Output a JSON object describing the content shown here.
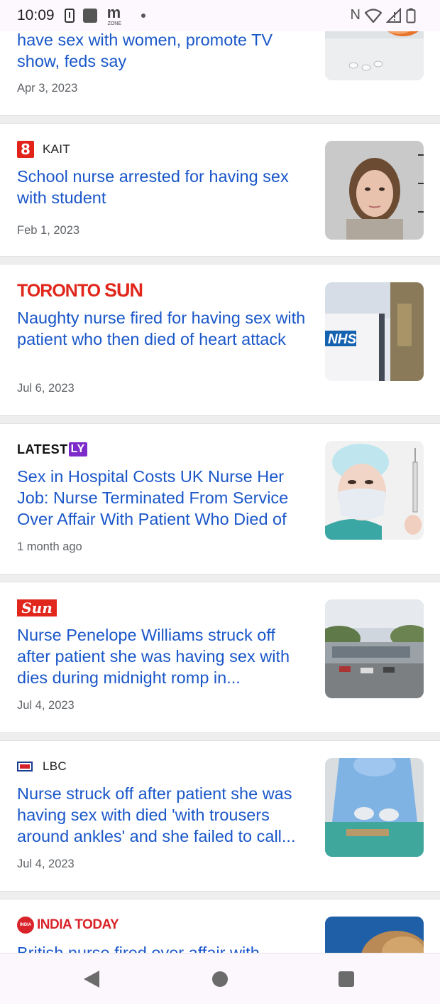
{
  "status_bar": {
    "time": "10:09",
    "mzone_letter": "m",
    "mzone_text": "ZONE",
    "nfc_letter": "N",
    "icons": [
      "alert-icon",
      "app-square-icon",
      "mzone-icon",
      "dot-icon",
      "nfc-icon",
      "wifi-icon",
      "signal-icon",
      "battery-icon"
    ]
  },
  "articles": [
    {
      "source": "",
      "headline": "have sex with women, promote TV show, feds say",
      "date": "Apr 3, 2023",
      "thumb": "pills-image"
    },
    {
      "source": "KAIT",
      "logo_glyph": "8",
      "headline": "School nurse arrested for having sex with student",
      "date": "Feb 1, 2023",
      "thumb": "mugshot-image"
    },
    {
      "source_a": "TORONTO",
      "source_b": "SUN",
      "headline": "Naughty nurse fired for having sex with patient who then died of heart attack",
      "date": "Jul 6, 2023",
      "thumb": "nhs-sign-image"
    },
    {
      "source_a": "LATEST",
      "source_b": "LY",
      "headline": "Sex in Hospital Costs UK Nurse Her Job: Nurse Terminated From Service Over Affair With Patient Who Died of",
      "date": "1 month ago",
      "thumb": "masked-nurse-image"
    },
    {
      "source": "Sun",
      "headline": "Nurse Penelope Williams struck off after patient she was having sex with dies during midnight romp in...",
      "date": "Jul 4, 2023",
      "thumb": "hospital-building-image"
    },
    {
      "source": "LBC",
      "headline": "Nurse struck off after patient she was having sex with died 'with trousers around ankles' and she failed to call...",
      "date": "Jul 4, 2023",
      "thumb": "surgeon-image"
    },
    {
      "source": "INDIA TODAY",
      "badge": "INDIA TODAY",
      "headline": "British nurse fired over affair with",
      "date": "",
      "thumb": "hair-image"
    }
  ],
  "colors": {
    "headline": "#1a57c9",
    "date": "#5f6368",
    "divider": "#eeeeef",
    "toronto_sun_red": "#e1261c",
    "latestly_purple": "#7d2cc9"
  }
}
